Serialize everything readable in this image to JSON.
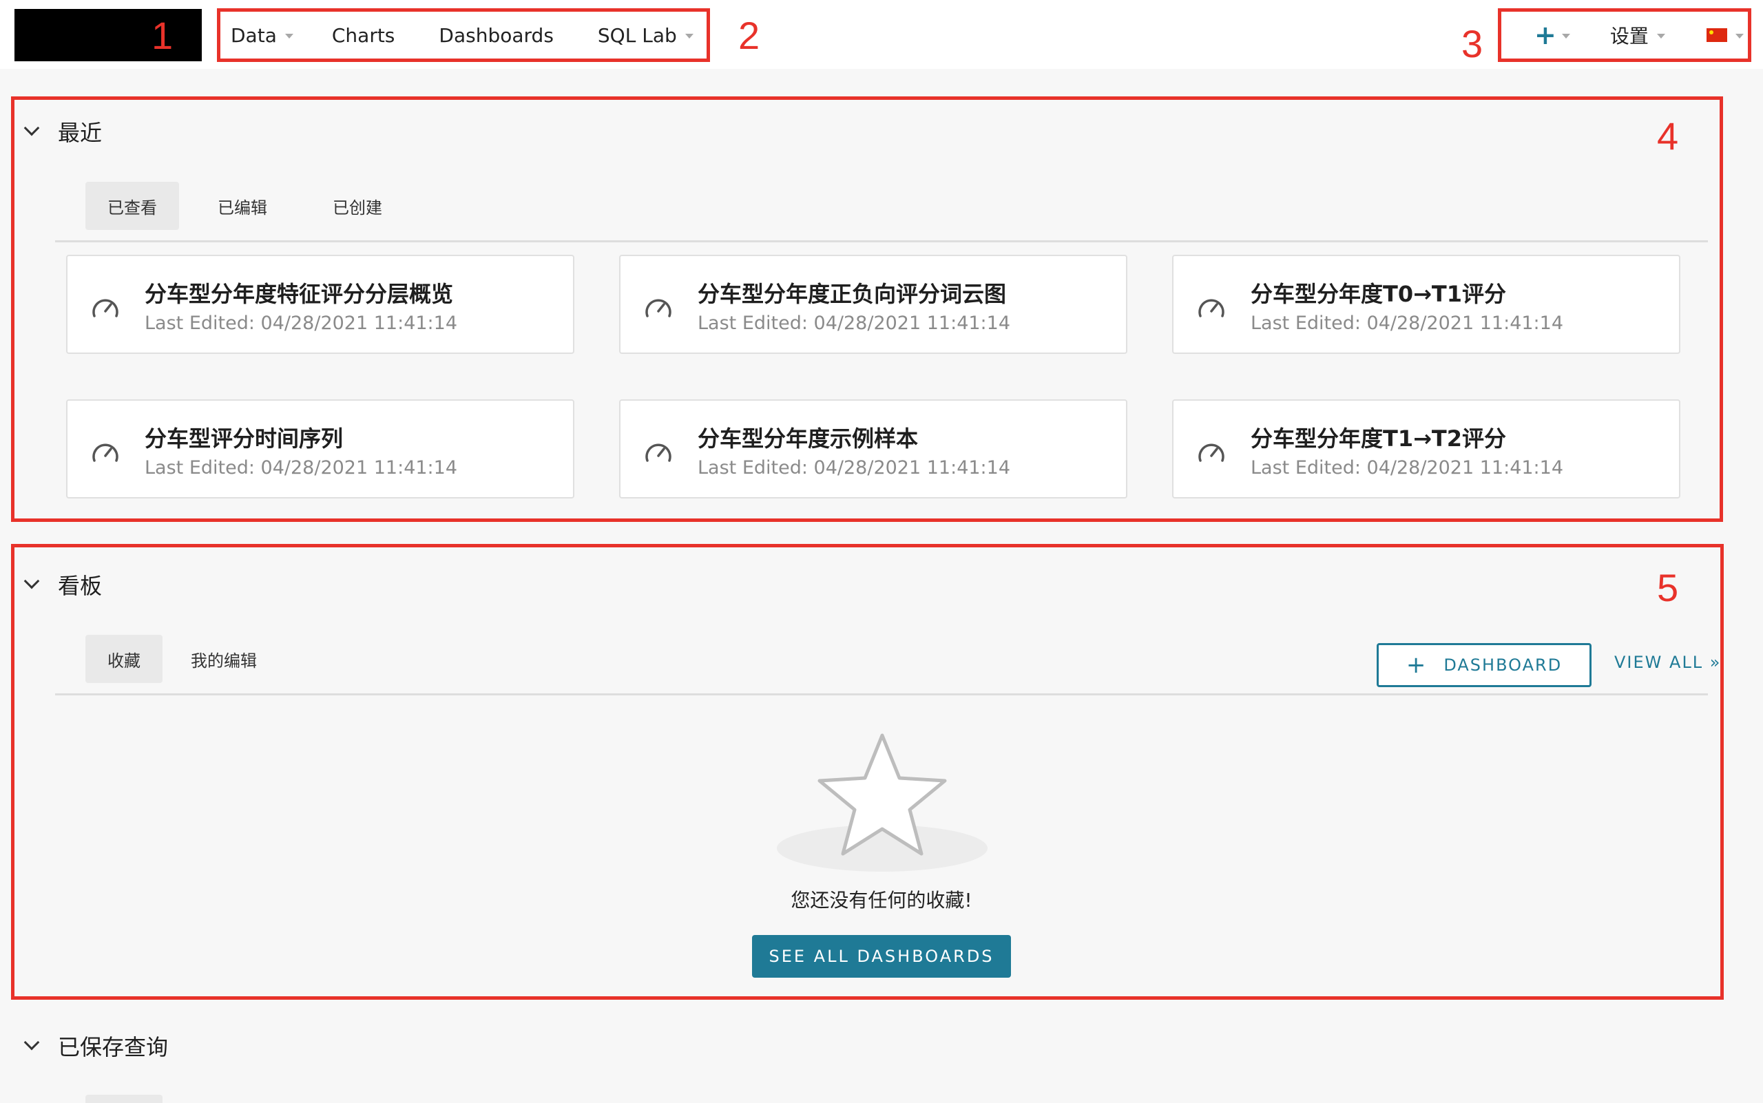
{
  "annotations": [
    "1",
    "2",
    "3",
    "4",
    "5"
  ],
  "nav": {
    "menu": [
      {
        "label": "Data",
        "dropdown": true
      },
      {
        "label": "Charts",
        "dropdown": false
      },
      {
        "label": "Dashboards",
        "dropdown": false
      },
      {
        "label": "SQL Lab",
        "dropdown": true
      }
    ],
    "right": {
      "plus_icon": "+",
      "settings_label": "设置",
      "language_flag": "cn-flag-icon"
    }
  },
  "recent": {
    "title": "最近",
    "tabs": [
      "已查看",
      "已编辑",
      "已创建"
    ],
    "active_tab": 0,
    "cards": [
      {
        "title": "分车型分年度特征评分分层概览",
        "subtitle": "Last Edited: 04/28/2021 11:41:14"
      },
      {
        "title": "分车型分年度正负向评分词云图",
        "subtitle": "Last Edited: 04/28/2021 11:41:14"
      },
      {
        "title": "分车型分年度T0→T1评分",
        "subtitle": "Last Edited: 04/28/2021 11:41:14"
      },
      {
        "title": "分车型评分时间序列",
        "subtitle": "Last Edited: 04/28/2021 11:41:14"
      },
      {
        "title": "分车型分年度示例样本",
        "subtitle": "Last Edited: 04/28/2021 11:41:14"
      },
      {
        "title": "分车型分年度T1→T2评分",
        "subtitle": "Last Edited: 04/28/2021 11:41:14"
      }
    ]
  },
  "dashboards": {
    "title": "看板",
    "tabs": [
      "收藏",
      "我的编辑"
    ],
    "active_tab": 0,
    "add_button": {
      "icon": "+",
      "label": "DASHBOARD"
    },
    "view_all": "VIEW ALL »",
    "empty_text": "您还没有任何的收藏!",
    "see_all_button": "SEE ALL DASHBOARDS"
  },
  "saved_queries": {
    "title": "已保存查询"
  },
  "colors": {
    "accent": "#1f7a96",
    "annotation": "#e8322a",
    "background": "#f7f7f7"
  }
}
